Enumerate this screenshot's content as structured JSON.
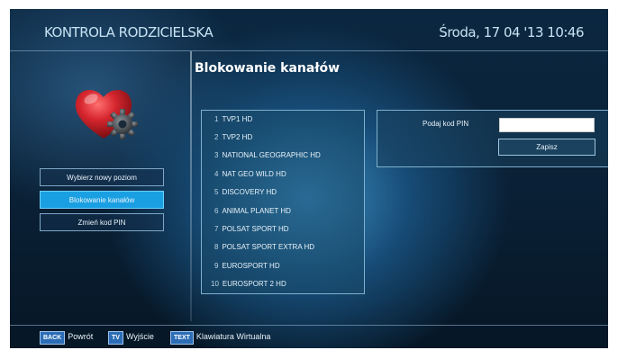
{
  "header": {
    "title": "KONTROLA RODZICIELSKA",
    "datetime": "Środa, 17 04 '13 10:46"
  },
  "section": {
    "title": "Blokowanie kanałów"
  },
  "menu": {
    "items": [
      {
        "label": "Wybierz nowy poziom",
        "active": false
      },
      {
        "label": "Blokowanie kanałów",
        "active": true
      },
      {
        "label": "Zmień kod PIN",
        "active": false
      }
    ]
  },
  "channels": [
    {
      "num": "1",
      "name": "TVP1 HD"
    },
    {
      "num": "2",
      "name": "TVP2 HD"
    },
    {
      "num": "3",
      "name": "NATIONAL GEOGRAPHIC HD"
    },
    {
      "num": "4",
      "name": "NAT GEO WILD HD"
    },
    {
      "num": "5",
      "name": "DISCOVERY HD"
    },
    {
      "num": "6",
      "name": "ANIMAL PLANET HD"
    },
    {
      "num": "7",
      "name": "POLSAT SPORT HD"
    },
    {
      "num": "8",
      "name": "POLSAT SPORT EXTRA HD"
    },
    {
      "num": "9",
      "name": "EUROSPORT HD"
    },
    {
      "num": "10",
      "name": "EUROSPORT 2 HD"
    }
  ],
  "pin": {
    "label": "Podaj kod PIN",
    "value": "",
    "save_label": "Zapisz"
  },
  "footer": {
    "back_key": "BACK",
    "back_label": "Powrót",
    "tv_key": "TV",
    "tv_label": "Wyjście",
    "text_key": "TEXT",
    "text_label": "Klawiatura Wirtualna"
  },
  "colors": {
    "accent": "#1aa0e2",
    "heart": "#d6262e",
    "gear": "#4a4f55"
  },
  "icons": {
    "parental_control": "heart-gear-icon"
  }
}
